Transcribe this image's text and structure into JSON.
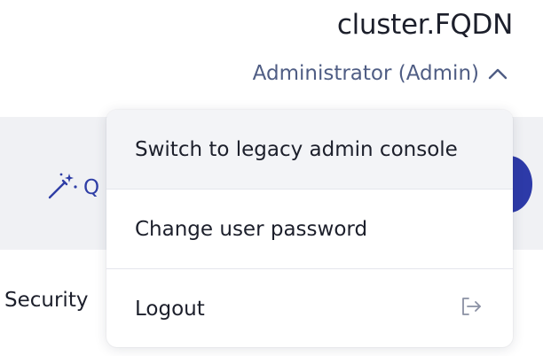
{
  "header": {
    "cluster_name": "cluster.FQDN",
    "user_menu_label": "Administrator (Admin)",
    "user_menu_icon": "chevron-up-icon"
  },
  "toolbar": {
    "quick_label": "Q",
    "quick_icon": "magic-wand-icon"
  },
  "panel": {
    "section_label": "Security"
  },
  "user_menu": {
    "items": [
      {
        "label": "Switch to legacy admin console"
      },
      {
        "label": "Change user password"
      },
      {
        "label": "Logout",
        "icon": "logout-icon"
      }
    ]
  },
  "colors": {
    "accent_blue": "#2d3aa8",
    "menu_trigger": "#4f5d84",
    "text": "#1c1f2b"
  }
}
